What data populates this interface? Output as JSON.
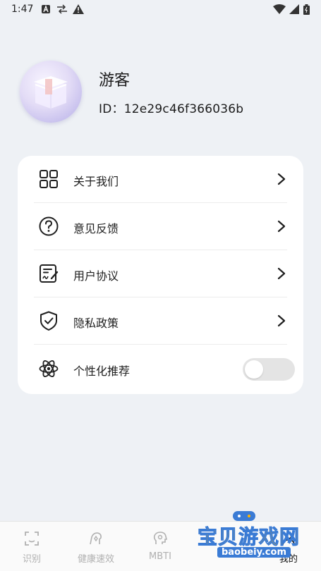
{
  "status_bar": {
    "time": "1:47"
  },
  "profile": {
    "name": "游客",
    "id_text": "ID：12e29c46f366036b"
  },
  "menu": {
    "items": [
      {
        "label": "关于我们",
        "icon": "grid-icon"
      },
      {
        "label": "意见反馈",
        "icon": "question-circle-icon"
      },
      {
        "label": "用户协议",
        "icon": "document-sign-icon"
      },
      {
        "label": "隐私政策",
        "icon": "shield-check-icon"
      }
    ],
    "toggle_item": {
      "label": "个性化推荐",
      "icon": "atom-icon",
      "enabled": false
    }
  },
  "bottom_nav": {
    "items": [
      {
        "label": "识别",
        "icon": "scan-icon"
      },
      {
        "label": "健康速效",
        "icon": "health-icon"
      },
      {
        "label": "MBTI",
        "icon": "head-icon"
      },
      {
        "label": "",
        "icon": ""
      },
      {
        "label": "我的",
        "icon": "profile-icon",
        "active": true
      }
    ]
  },
  "watermark": {
    "text": "宝贝游戏网",
    "domain": "baobeiy.com"
  },
  "colors": {
    "background": "#eef1f5",
    "card": "#ffffff",
    "toggle_off": "#e4e4e4",
    "nav_inactive": "#b0b0b0"
  }
}
